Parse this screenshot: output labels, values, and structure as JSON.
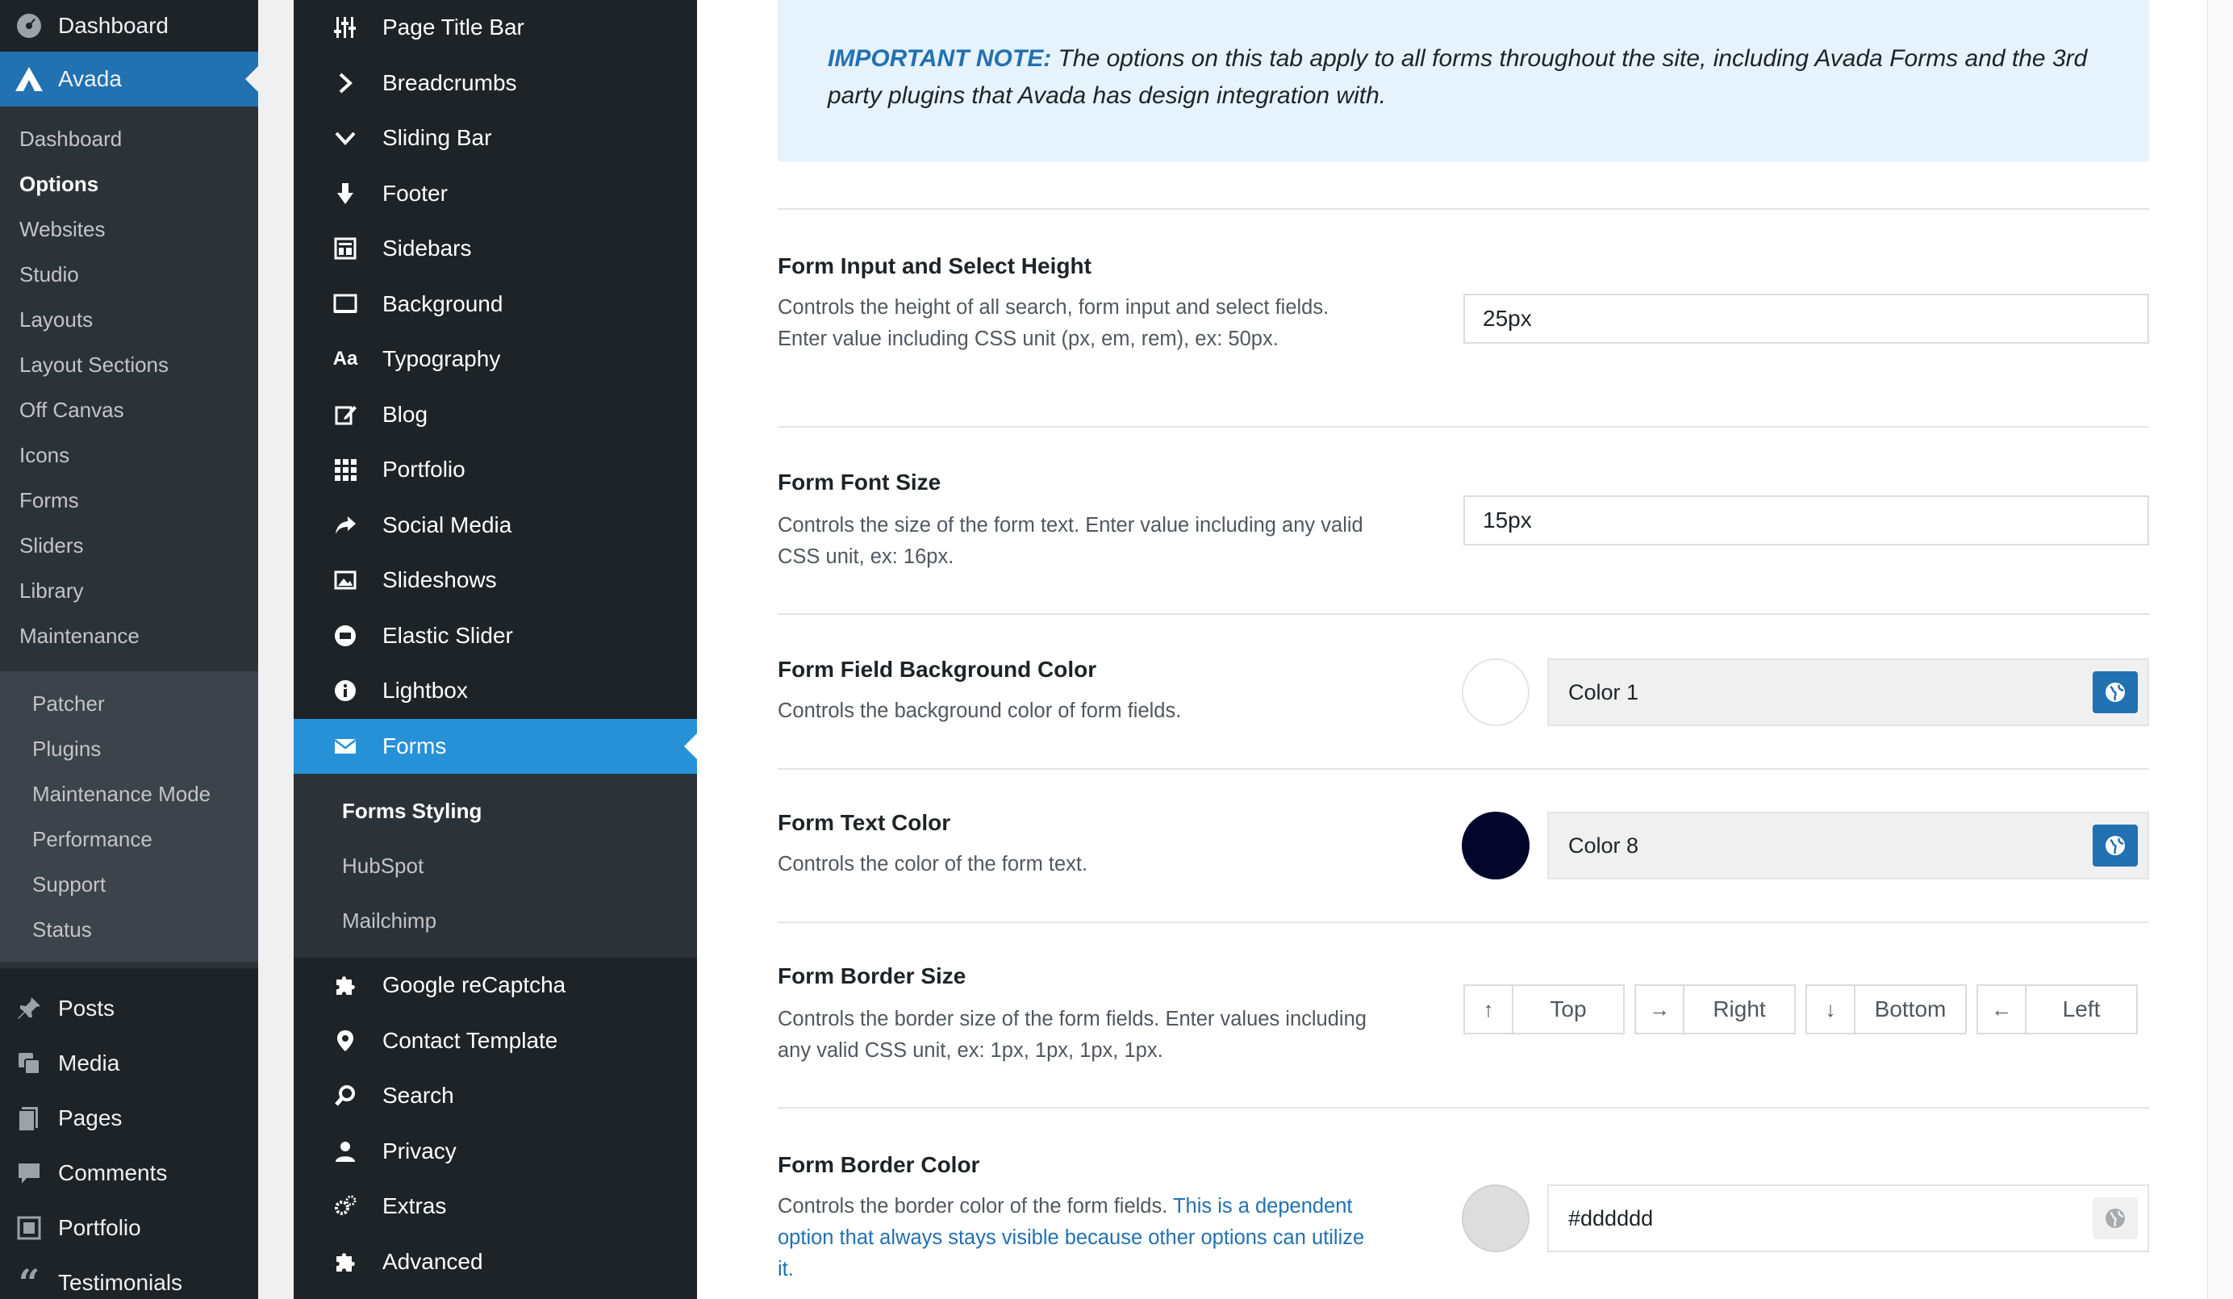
{
  "wp_menu": {
    "top_items": [
      {
        "label": "Dashboard",
        "icon": "dashboard-icon"
      },
      {
        "label": "Avada",
        "icon": "avada-logo-icon"
      }
    ],
    "avada_sub": [
      "Dashboard",
      "Options",
      "Websites",
      "Studio",
      "Layouts",
      "Layout Sections",
      "Off Canvas",
      "Icons",
      "Forms",
      "Sliders",
      "Library",
      "Maintenance"
    ],
    "avada_sub_current": "Options",
    "maintenance_sub": [
      "Patcher",
      "Plugins",
      "Maintenance Mode",
      "Performance",
      "Support",
      "Status"
    ],
    "lower_items": [
      {
        "label": "Posts",
        "icon": "pin-icon"
      },
      {
        "label": "Media",
        "icon": "media-icon"
      },
      {
        "label": "Pages",
        "icon": "pages-icon"
      },
      {
        "label": "Comments",
        "icon": "comment-icon"
      },
      {
        "label": "Portfolio",
        "icon": "portfolio-icon"
      },
      {
        "label": "Testimonials",
        "icon": "quote-icon"
      }
    ]
  },
  "avada_menu": {
    "items_top": [
      {
        "label": "Page Title Bar",
        "icon": "sliders-icon"
      },
      {
        "label": "Breadcrumbs",
        "icon": "chevron-right-icon"
      },
      {
        "label": "Sliding Bar",
        "icon": "chevron-down-icon"
      },
      {
        "label": "Footer",
        "icon": "arrow-down-icon"
      },
      {
        "label": "Sidebars",
        "icon": "sidebar-icon"
      },
      {
        "label": "Background",
        "icon": "monitor-icon"
      },
      {
        "label": "Typography",
        "icon": "typography-icon",
        "glyph": "Aa"
      },
      {
        "label": "Blog",
        "icon": "edit-icon"
      },
      {
        "label": "Portfolio",
        "icon": "grid-icon"
      },
      {
        "label": "Social Media",
        "icon": "share-icon"
      },
      {
        "label": "Slideshows",
        "icon": "image-icon"
      },
      {
        "label": "Elastic Slider",
        "icon": "elastic-icon"
      },
      {
        "label": "Lightbox",
        "icon": "info-icon"
      }
    ],
    "current": {
      "label": "Forms",
      "icon": "envelope-icon"
    },
    "forms_sub": [
      "Forms Styling",
      "HubSpot",
      "Mailchimp"
    ],
    "forms_sub_current": "Forms Styling",
    "items_bottom": [
      {
        "label": "Google reCaptcha",
        "icon": "puzzle-icon"
      },
      {
        "label": "Contact Template",
        "icon": "map-pin-icon"
      },
      {
        "label": "Search",
        "icon": "search-icon"
      },
      {
        "label": "Privacy",
        "icon": "user-icon"
      },
      {
        "label": "Extras",
        "icon": "gears-icon"
      },
      {
        "label": "Advanced",
        "icon": "puzzle-icon"
      }
    ]
  },
  "note": {
    "label": "IMPORTANT NOTE:",
    "text": " The options on this tab apply to all forms throughout the site, including Avada Forms and the 3rd party plugins that Avada has design integration with."
  },
  "options": {
    "input_height": {
      "title": "Form Input and Select Height",
      "desc": "Controls the height of all search, form input and select fields. Enter value including CSS unit (px, em, rem), ex: 50px.",
      "value": "25px"
    },
    "font_size": {
      "title": "Form Font Size",
      "desc": "Controls the size of the form text. Enter value including any valid CSS unit, ex: 16px.",
      "value": "15px"
    },
    "bg_color": {
      "title": "Form Field Background Color",
      "desc": "Controls the background color of form fields.",
      "value": "Color 1",
      "swatch": "#ffffff"
    },
    "text_color": {
      "title": "Form Text Color",
      "desc": "Controls the color of the form text.",
      "value": "Color 8",
      "swatch": "#03052b"
    },
    "border_size": {
      "title": "Form Border Size",
      "desc": "Controls the border size of the form fields. Enter values including any valid CSS unit, ex: 1px, 1px, 1px, 1px.",
      "fields": [
        {
          "arrow": "↑",
          "label": "Top"
        },
        {
          "arrow": "→",
          "label": "Right"
        },
        {
          "arrow": "↓",
          "label": "Bottom"
        },
        {
          "arrow": "←",
          "label": "Left"
        }
      ]
    },
    "border_color": {
      "title": "Form Border Color",
      "desc": "Controls the border color of the form fields. ",
      "desc_link": "This is a dependent option that always stays visible because other options can utilize it.",
      "value": "#dddddd",
      "swatch": "#dddddd"
    }
  },
  "colors": {
    "wp_sidebar": "#1d2327",
    "wp_active": "#2271b1",
    "avada_active": "#2791d8",
    "note_bg": "#e6f2fc"
  }
}
